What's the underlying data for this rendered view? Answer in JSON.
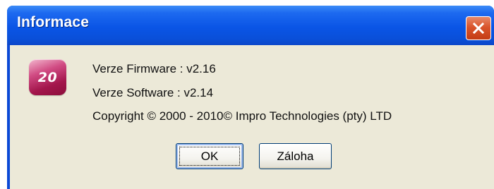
{
  "window": {
    "title": "Informace",
    "close_icon": "close-icon"
  },
  "app_icon": {
    "name": "impro-20-logo-icon",
    "text": "20"
  },
  "info": {
    "firmware": "Verze Firmware : v2.16",
    "software": "Verze Software : v2.14",
    "copyright": "Copyright © 2000 - 2010© Impro Technologies (pty) LTD"
  },
  "buttons": {
    "ok": "OK",
    "zaloha": "Záloha"
  },
  "colors": {
    "titlebar": "#0a55e6",
    "client": "#ece9d8",
    "close": "#d9542c",
    "icon": "#a3164c"
  }
}
